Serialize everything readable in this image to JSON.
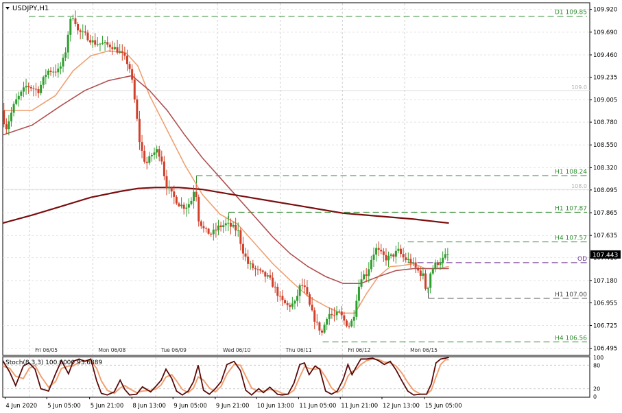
{
  "chart_data": {
    "type": "candlestick",
    "title": "USDJPY,H1",
    "price_axis": {
      "ylim": [
        106.43,
        109.98
      ],
      "ticks": [
        "109.920",
        "109.690",
        "109.460",
        "109.235",
        "109.005",
        "108.780",
        "108.550",
        "108.320",
        "108.095",
        "107.865",
        "107.635",
        "107.410",
        "107.180",
        "106.955",
        "106.725",
        "106.495"
      ]
    },
    "current_price": {
      "label": "107.443",
      "value": 107.443,
      "color": "#000000"
    },
    "levels": [
      {
        "label": "D1 109.85",
        "value": 109.85,
        "x_from": 0.045,
        "color": "#2e8b2e"
      },
      {
        "label": "H1 108.24",
        "value": 108.24,
        "x_from": 0.33,
        "color": "#2e8b2e"
      },
      {
        "label": "H1 107.87",
        "value": 107.87,
        "x_from": 0.385,
        "color": "#2e8b2e"
      },
      {
        "label": "H4 107.57",
        "value": 107.57,
        "x_from": 0.69,
        "color": "#2e8b2e"
      },
      {
        "label": "OD",
        "value": 107.36,
        "x_from": 0.69,
        "color": "#6a2c8a"
      },
      {
        "label": "H1 107.00",
        "value": 107.0,
        "x_from": 0.725,
        "color": "#444444"
      },
      {
        "label": "H4 106.56",
        "value": 106.56,
        "x_from": 0.545,
        "color": "#2e8b2e"
      }
    ],
    "round_levels": [
      {
        "label": "109.0",
        "value": 109.1
      },
      {
        "label": "108.0",
        "value": 108.1
      }
    ],
    "day_labels": [
      {
        "label": "Fri 06/05",
        "pos": 0.055
      },
      {
        "label": "Mon 06/08",
        "pos": 0.163
      },
      {
        "label": "Tue 06/09",
        "pos": 0.27
      },
      {
        "label": "Wed 06/10",
        "pos": 0.375
      },
      {
        "label": "Thu 06/11",
        "pos": 0.482
      },
      {
        "label": "Fri 06/12",
        "pos": 0.588
      },
      {
        "label": "Mon 06/15",
        "pos": 0.694
      }
    ],
    "time_labels": [
      {
        "label": "4 Jun 2020",
        "pos": 0.004
      },
      {
        "label": "5 Jun 05:00",
        "pos": 0.075
      },
      {
        "label": "5 Jun 21:00",
        "pos": 0.148
      },
      {
        "label": "8 Jun 13:00",
        "pos": 0.22
      },
      {
        "label": "9 Jun 05:00",
        "pos": 0.29
      },
      {
        "label": "9 Jun 21:00",
        "pos": 0.362
      },
      {
        "label": "10 Jun 13:00",
        "pos": 0.432
      },
      {
        "label": "11 Jun 05:00",
        "pos": 0.504
      },
      {
        "label": "11 Jun 21:00",
        "pos": 0.575
      },
      {
        "label": "12 Jun 13:00",
        "pos": 0.646
      },
      {
        "label": "15 Jun 05:00",
        "pos": 0.718
      }
    ],
    "price_path": [
      [
        0.0,
        108.9
      ],
      [
        0.01,
        108.72
      ],
      [
        0.025,
        108.98
      ],
      [
        0.045,
        109.15
      ],
      [
        0.065,
        109.1
      ],
      [
        0.08,
        109.3
      ],
      [
        0.1,
        109.3
      ],
      [
        0.11,
        109.45
      ],
      [
        0.118,
        109.78
      ],
      [
        0.125,
        109.87
      ],
      [
        0.132,
        109.7
      ],
      [
        0.145,
        109.66
      ],
      [
        0.16,
        109.58
      ],
      [
        0.175,
        109.57
      ],
      [
        0.19,
        109.55
      ],
      [
        0.205,
        109.48
      ],
      [
        0.215,
        109.4
      ],
      [
        0.222,
        109.3
      ],
      [
        0.23,
        108.95
      ],
      [
        0.238,
        108.55
      ],
      [
        0.248,
        108.35
      ],
      [
        0.258,
        108.45
      ],
      [
        0.268,
        108.5
      ],
      [
        0.275,
        108.4
      ],
      [
        0.282,
        108.15
      ],
      [
        0.292,
        108.05
      ],
      [
        0.305,
        107.95
      ],
      [
        0.315,
        107.92
      ],
      [
        0.325,
        107.98
      ],
      [
        0.332,
        108.15
      ],
      [
        0.338,
        107.8
      ],
      [
        0.348,
        107.68
      ],
      [
        0.36,
        107.65
      ],
      [
        0.372,
        107.72
      ],
      [
        0.385,
        107.75
      ],
      [
        0.395,
        107.72
      ],
      [
        0.405,
        107.68
      ],
      [
        0.412,
        107.5
      ],
      [
        0.422,
        107.35
      ],
      [
        0.432,
        107.3
      ],
      [
        0.445,
        107.25
      ],
      [
        0.458,
        107.2
      ],
      [
        0.468,
        107.1
      ],
      [
        0.478,
        106.98
      ],
      [
        0.49,
        106.92
      ],
      [
        0.502,
        106.95
      ],
      [
        0.512,
        107.15
      ],
      [
        0.52,
        107.08
      ],
      [
        0.528,
        106.9
      ],
      [
        0.538,
        106.75
      ],
      [
        0.548,
        106.65
      ],
      [
        0.558,
        106.85
      ],
      [
        0.568,
        106.82
      ],
      [
        0.578,
        106.85
      ],
      [
        0.588,
        106.75
      ],
      [
        0.596,
        106.72
      ],
      [
        0.603,
        106.85
      ],
      [
        0.608,
        107.05
      ],
      [
        0.615,
        107.22
      ],
      [
        0.625,
        107.25
      ],
      [
        0.633,
        107.42
      ],
      [
        0.64,
        107.5
      ],
      [
        0.648,
        107.45
      ],
      [
        0.658,
        107.4
      ],
      [
        0.668,
        107.43
      ],
      [
        0.678,
        107.48
      ],
      [
        0.688,
        107.4
      ],
      [
        0.698,
        107.38
      ],
      [
        0.708,
        107.3
      ],
      [
        0.716,
        107.25
      ],
      [
        0.722,
        107.22
      ],
      [
        0.726,
        107.03
      ],
      [
        0.732,
        107.25
      ],
      [
        0.742,
        107.35
      ],
      [
        0.752,
        107.38
      ],
      [
        0.76,
        107.44
      ]
    ],
    "ma_series": [
      {
        "color": "#f0a070",
        "width": 1.6,
        "points": [
          [
            0.0,
            108.9
          ],
          [
            0.05,
            108.9
          ],
          [
            0.09,
            109.05
          ],
          [
            0.12,
            109.3
          ],
          [
            0.15,
            109.45
          ],
          [
            0.18,
            109.5
          ],
          [
            0.21,
            109.48
          ],
          [
            0.23,
            109.35
          ],
          [
            0.25,
            109.05
          ],
          [
            0.28,
            108.7
          ],
          [
            0.31,
            108.35
          ],
          [
            0.34,
            108.05
          ],
          [
            0.37,
            107.85
          ],
          [
            0.4,
            107.75
          ],
          [
            0.43,
            107.55
          ],
          [
            0.46,
            107.35
          ],
          [
            0.49,
            107.18
          ],
          [
            0.52,
            107.02
          ],
          [
            0.55,
            106.92
          ],
          [
            0.575,
            106.85
          ],
          [
            0.6,
            106.85
          ],
          [
            0.62,
            107.05
          ],
          [
            0.64,
            107.22
          ],
          [
            0.66,
            107.32
          ],
          [
            0.68,
            107.33
          ],
          [
            0.7,
            107.35
          ],
          [
            0.72,
            107.3
          ],
          [
            0.74,
            107.3
          ],
          [
            0.76,
            107.32
          ]
        ]
      },
      {
        "color": "#b05050",
        "width": 1.6,
        "points": [
          [
            0.0,
            108.65
          ],
          [
            0.05,
            108.75
          ],
          [
            0.1,
            108.95
          ],
          [
            0.14,
            109.1
          ],
          [
            0.18,
            109.2
          ],
          [
            0.22,
            109.25
          ],
          [
            0.25,
            109.1
          ],
          [
            0.28,
            108.9
          ],
          [
            0.31,
            108.65
          ],
          [
            0.34,
            108.42
          ],
          [
            0.37,
            108.22
          ],
          [
            0.4,
            108.02
          ],
          [
            0.43,
            107.82
          ],
          [
            0.46,
            107.62
          ],
          [
            0.49,
            107.45
          ],
          [
            0.52,
            107.32
          ],
          [
            0.55,
            107.22
          ],
          [
            0.58,
            107.15
          ],
          [
            0.61,
            107.15
          ],
          [
            0.64,
            107.22
          ],
          [
            0.67,
            107.28
          ],
          [
            0.7,
            107.3
          ],
          [
            0.73,
            107.3
          ],
          [
            0.76,
            107.3
          ]
        ]
      },
      {
        "color": "#7a0e0e",
        "width": 2.2,
        "points": [
          [
            0.0,
            107.76
          ],
          [
            0.05,
            107.84
          ],
          [
            0.1,
            107.93
          ],
          [
            0.15,
            108.02
          ],
          [
            0.2,
            108.08
          ],
          [
            0.23,
            108.11
          ],
          [
            0.26,
            108.12
          ],
          [
            0.3,
            108.12
          ],
          [
            0.34,
            108.1
          ],
          [
            0.38,
            108.06
          ],
          [
            0.42,
            108.02
          ],
          [
            0.46,
            107.98
          ],
          [
            0.5,
            107.94
          ],
          [
            0.54,
            107.9
          ],
          [
            0.58,
            107.86
          ],
          [
            0.62,
            107.84
          ],
          [
            0.66,
            107.82
          ],
          [
            0.7,
            107.8
          ],
          [
            0.76,
            107.76
          ]
        ]
      }
    ],
    "oscillator": {
      "label": "Stoch(8,3,3) 100.0000 93.6889",
      "levels": [
        "100",
        "80",
        "20",
        "0"
      ],
      "grid_values": [
        80,
        20
      ],
      "main_color": "#5a0a0a",
      "signal_color": "#f0a070",
      "main": [
        [
          0.0,
          92
        ],
        [
          0.012,
          62
        ],
        [
          0.022,
          28
        ],
        [
          0.035,
          78
        ],
        [
          0.045,
          86
        ],
        [
          0.055,
          70
        ],
        [
          0.065,
          20
        ],
        [
          0.078,
          14
        ],
        [
          0.09,
          58
        ],
        [
          0.1,
          92
        ],
        [
          0.112,
          58
        ],
        [
          0.12,
          90
        ],
        [
          0.13,
          96
        ],
        [
          0.14,
          90
        ],
        [
          0.15,
          96
        ],
        [
          0.16,
          40
        ],
        [
          0.168,
          8
        ],
        [
          0.178,
          4
        ],
        [
          0.19,
          12
        ],
        [
          0.2,
          42
        ],
        [
          0.208,
          18
        ],
        [
          0.216,
          4
        ],
        [
          0.228,
          6
        ],
        [
          0.238,
          25
        ],
        [
          0.252,
          12
        ],
        [
          0.262,
          28
        ],
        [
          0.27,
          42
        ],
        [
          0.278,
          70
        ],
        [
          0.288,
          46
        ],
        [
          0.296,
          14
        ],
        [
          0.306,
          4
        ],
        [
          0.316,
          14
        ],
        [
          0.325,
          38
        ],
        [
          0.333,
          80
        ],
        [
          0.342,
          16
        ],
        [
          0.352,
          6
        ],
        [
          0.362,
          20
        ],
        [
          0.372,
          38
        ],
        [
          0.382,
          82
        ],
        [
          0.394,
          90
        ],
        [
          0.405,
          66
        ],
        [
          0.414,
          16
        ],
        [
          0.424,
          4
        ],
        [
          0.436,
          20
        ],
        [
          0.444,
          10
        ],
        [
          0.455,
          24
        ],
        [
          0.468,
          6
        ],
        [
          0.476,
          4
        ],
        [
          0.486,
          6
        ],
        [
          0.496,
          34
        ],
        [
          0.506,
          82
        ],
        [
          0.514,
          86
        ],
        [
          0.522,
          56
        ],
        [
          0.532,
          78
        ],
        [
          0.54,
          70
        ],
        [
          0.55,
          14
        ],
        [
          0.56,
          6
        ],
        [
          0.57,
          14
        ],
        [
          0.58,
          44
        ],
        [
          0.588,
          82
        ],
        [
          0.595,
          56
        ],
        [
          0.603,
          78
        ],
        [
          0.61,
          96
        ],
        [
          0.62,
          96
        ],
        [
          0.63,
          98
        ],
        [
          0.64,
          92
        ],
        [
          0.65,
          82
        ],
        [
          0.66,
          90
        ],
        [
          0.67,
          68
        ],
        [
          0.68,
          40
        ],
        [
          0.69,
          14
        ],
        [
          0.7,
          4
        ],
        [
          0.712,
          6
        ],
        [
          0.722,
          6
        ],
        [
          0.73,
          32
        ],
        [
          0.738,
          86
        ],
        [
          0.746,
          96
        ],
        [
          0.754,
          98
        ],
        [
          0.76,
          100
        ]
      ],
      "signal": [
        [
          0.0,
          78
        ],
        [
          0.012,
          72
        ],
        [
          0.022,
          52
        ],
        [
          0.035,
          46
        ],
        [
          0.045,
          72
        ],
        [
          0.055,
          80
        ],
        [
          0.065,
          52
        ],
        [
          0.078,
          24
        ],
        [
          0.09,
          38
        ],
        [
          0.1,
          72
        ],
        [
          0.112,
          78
        ],
        [
          0.12,
          78
        ],
        [
          0.13,
          88
        ],
        [
          0.14,
          92
        ],
        [
          0.15,
          92
        ],
        [
          0.16,
          72
        ],
        [
          0.168,
          40
        ],
        [
          0.178,
          16
        ],
        [
          0.19,
          8
        ],
        [
          0.2,
          22
        ],
        [
          0.208,
          28
        ],
        [
          0.216,
          20
        ],
        [
          0.228,
          10
        ],
        [
          0.238,
          14
        ],
        [
          0.252,
          16
        ],
        [
          0.262,
          20
        ],
        [
          0.27,
          30
        ],
        [
          0.278,
          50
        ],
        [
          0.288,
          56
        ],
        [
          0.296,
          40
        ],
        [
          0.306,
          18
        ],
        [
          0.316,
          10
        ],
        [
          0.325,
          22
        ],
        [
          0.333,
          50
        ],
        [
          0.342,
          42
        ],
        [
          0.352,
          22
        ],
        [
          0.362,
          12
        ],
        [
          0.372,
          26
        ],
        [
          0.382,
          58
        ],
        [
          0.394,
          82
        ],
        [
          0.405,
          80
        ],
        [
          0.414,
          52
        ],
        [
          0.424,
          22
        ],
        [
          0.436,
          12
        ],
        [
          0.444,
          14
        ],
        [
          0.455,
          18
        ],
        [
          0.468,
          14
        ],
        [
          0.476,
          8
        ],
        [
          0.486,
          6
        ],
        [
          0.496,
          16
        ],
        [
          0.506,
          50
        ],
        [
          0.514,
          76
        ],
        [
          0.522,
          72
        ],
        [
          0.532,
          70
        ],
        [
          0.54,
          72
        ],
        [
          0.55,
          50
        ],
        [
          0.56,
          22
        ],
        [
          0.57,
          10
        ],
        [
          0.58,
          22
        ],
        [
          0.588,
          52
        ],
        [
          0.595,
          64
        ],
        [
          0.603,
          70
        ],
        [
          0.61,
          82
        ],
        [
          0.62,
          92
        ],
        [
          0.63,
          96
        ],
        [
          0.64,
          95
        ],
        [
          0.65,
          88
        ],
        [
          0.66,
          86
        ],
        [
          0.67,
          78
        ],
        [
          0.68,
          60
        ],
        [
          0.69,
          36
        ],
        [
          0.7,
          16
        ],
        [
          0.712,
          6
        ],
        [
          0.722,
          6
        ],
        [
          0.73,
          16
        ],
        [
          0.738,
          50
        ],
        [
          0.746,
          82
        ],
        [
          0.754,
          94
        ],
        [
          0.76,
          94
        ]
      ]
    }
  }
}
